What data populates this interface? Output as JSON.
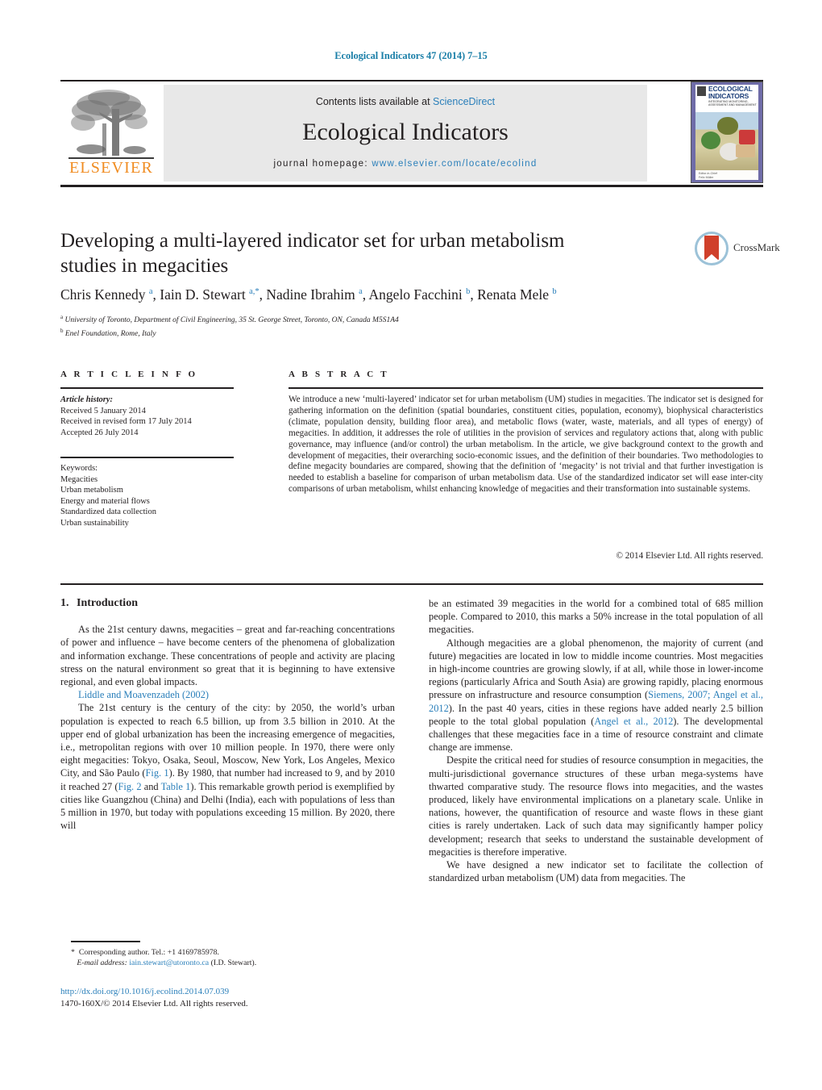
{
  "running_head": "Ecological Indicators 47 (2014) 7–15",
  "masthead": {
    "publisher_name": "ELSEVIER",
    "contents_prefix": "Contents lists available at ",
    "contents_link": "ScienceDirect",
    "journal_title": "Ecological Indicators",
    "homepage_prefix": "journal homepage: ",
    "homepage_url": "www.elsevier.com/locate/ecolind",
    "cover": {
      "line1": "ECOLOGICAL",
      "line2": "INDICATORS",
      "subtitle": "INTEGRATING MONITORING, ASSESSMENT AND MANAGEMENT",
      "footer1": "Editor-in-Chief",
      "footer2": "Felix Müller"
    }
  },
  "article": {
    "title": "Developing a multi-layered indicator set for urban metabolism studies in megacities",
    "authors": "Chris Kennedy a, Iain D. Stewart a,*, Nadine Ibrahim a, Angelo Facchini b, Renata Mele b",
    "affiliation_a": "University of Toronto, Department of Civil Engineering, 35 St. George Street, Toronto, ON, Canada M5S1A4",
    "affiliation_b": "Enel Foundation, Rome, Italy",
    "crossmark_label": "CrossMark"
  },
  "article_info": {
    "heading": "A R T I C L E   I N F O",
    "history_label": "Article history:",
    "history": [
      "Received 5 January 2014",
      "Received in revised form 17 July 2014",
      "Accepted 26 July 2014"
    ],
    "keywords_label": "Keywords:",
    "keywords": [
      "Megacities",
      "Urban metabolism",
      "Energy and material flows",
      "Standardized data collection",
      "Urban sustainability"
    ]
  },
  "abstract": {
    "heading": "A B S T R A C T",
    "text": "We introduce a new ‘multi-layered’ indicator set for urban metabolism (UM) studies in megacities. The indicator set is designed for gathering information on the definition (spatial boundaries, constituent cities, population, economy), biophysical characteristics (climate, population density, building floor area), and metabolic flows (water, waste, materials, and all types of energy) of megacities. In addition, it addresses the role of utilities in the provision of services and regulatory actions that, along with public governance, may influence (and/or control) the urban metabolism. In the article, we give background context to the growth and development of megacities, their overarching socio-economic issues, and the definition of their boundaries. Two methodologies to define megacity boundaries are compared, showing that the definition of ‘megacity’ is not trivial and that further investigation is needed to establish a baseline for comparison of urban metabolism data. Use of the standardized indicator set will ease inter-city comparisons of urban metabolism, whilst enhancing knowledge of megacities and their transformation into sustainable systems.",
    "copyright": "© 2014 Elsevier Ltd. All rights reserved."
  },
  "introduction": {
    "number": "1.",
    "heading": "Introduction",
    "quote": "As the 21st century dawns, megacities – great and far-reaching concentrations of power and influence – have become centers of the phenomena of globalization and information exchange. These concentrations of people and activity are placing stress on the natural environment so great that it is beginning to have extensive regional, and even global impacts.",
    "quote_attrib": "Liddle and Moavenzadeh (2002)",
    "para_left_1a": "The 21st century is the century of the city: by 2050, the world’s urban population is expected to reach 6.5 billion, up from 3.5 billion in 2010. At the upper end of global urbanization has been the increasing emergence of megacities, i.e., metropolitan regions with over 10 million people. In 1970, there were only eight megacities: Tokyo, Osaka, Seoul, Moscow, New York, Los Angeles, Mexico City, and São Paulo (",
    "fig1": "Fig. 1",
    "para_left_1b": "). By 1980, that number had increased to 9, and by 2010 it reached 27 (",
    "fig2": "Fig. 2",
    "and_word": " and ",
    "table1": "Table 1",
    "para_left_1c": "). This remarkable growth period is exemplified by cities like Guangzhou (China) and Delhi (India), each with populations of less than 5 million in 1970, but today with populations exceeding 15 million. By 2020, there will",
    "para_right_1": "be an estimated 39 megacities in the world for a combined total of 685 million people. Compared to 2010, this marks a 50% increase in the total population of all megacities.",
    "para_right_2a": "Although megacities are a global phenomenon, the majority of current (and future) megacities are located in low to middle income countries. Most megacities in high-income countries are growing slowly, if at all, while those in lower-income regions (particularly Africa and South Asia) are growing rapidly, placing enormous pressure on infrastructure and resource consumption (",
    "cite_siemens": "Siemens, 2007; Angel et al., 2012",
    "para_right_2b": "). In the past 40 years, cities in these regions have added nearly 2.5 billion people to the total global population (",
    "cite_angel": "Angel et al., 2012",
    "para_right_2c": "). The developmental challenges that these megacities face in a time of resource constraint and climate change are immense.",
    "para_right_3": "Despite the critical need for studies of resource consumption in megacities, the multi-jurisdictional governance structures of these urban mega-systems have thwarted comparative study. The resource flows into megacities, and the wastes produced, likely have environmental implications on a planetary scale. Unlike in nations, however, the quantification of resource and waste flows in these giant cities is rarely undertaken. Lack of such data may significantly hamper policy development; research that seeks to understand the sustainable development of megacities is therefore imperative.",
    "para_right_4": "We have designed a new indicator set to facilitate the collection of standardized urban metabolism (UM) data from megacities. The"
  },
  "footer": {
    "corresponding_marker": "*",
    "corresponding_text": "Corresponding author. Tel.: +1 4169785978.",
    "email_label": "E-mail address:",
    "email": "iain.stewart@utoronto.ca",
    "email_owner": "(I.D. Stewart).",
    "doi": "http://dx.doi.org/10.1016/j.ecolind.2014.07.039",
    "issn_line": "1470-160X/© 2014 Elsevier Ltd. All rights reserved."
  },
  "colors": {
    "link": "#2a7fba",
    "elsevier_orange": "#f08c21",
    "rule": "#231f20",
    "band": "#e8e8e8"
  }
}
